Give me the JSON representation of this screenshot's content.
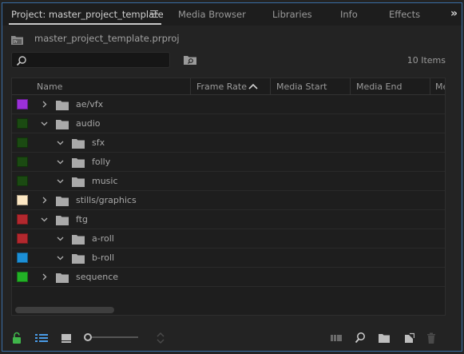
{
  "tabs": [
    {
      "label": "Project: master_project_template",
      "active": true
    },
    {
      "label": "Media Browser"
    },
    {
      "label": "Libraries"
    },
    {
      "label": "Info"
    },
    {
      "label": "Effects"
    }
  ],
  "tab_overflow_label": "»",
  "project_file": "master_project_template.prproj",
  "search": {
    "value": "",
    "placeholder": ""
  },
  "item_count": "10 Items",
  "columns": [
    "Name",
    "Frame Rate",
    "Media Start",
    "Media End",
    "Me"
  ],
  "sorted_column": "Frame Rate",
  "sort_direction": "ascending",
  "rows": [
    {
      "label": "ae/vfx",
      "color": "#9b30d9",
      "expanded": false
    },
    {
      "label": "audio",
      "color": "#1b4a12",
      "expanded": true
    },
    {
      "label": "sfx",
      "color": "#1b4a12",
      "expanded": true
    },
    {
      "label": "folly",
      "color": "#1b4a12",
      "expanded": true
    },
    {
      "label": "music",
      "color": "#1b4a12",
      "expanded": true
    },
    {
      "label": "stills/graphics",
      "color": "#fde8c4",
      "expanded": false
    },
    {
      "label": "ftg",
      "color": "#b3282e",
      "expanded": true
    },
    {
      "label": "a-roll",
      "color": "#b3282e",
      "expanded": true
    },
    {
      "label": "b-roll",
      "color": "#1c8fd6",
      "expanded": true
    },
    {
      "label": "sequence",
      "color": "#22b126",
      "expanded": false
    }
  ],
  "toolbar": {
    "icons": [
      "lock-icon",
      "list-view-icon",
      "icon-view-icon",
      "zoom-slider",
      "sort-icons-icon",
      "automate-to-sequence-icon",
      "find-icon",
      "new-bin-icon",
      "new-item-icon",
      "clear-icon"
    ]
  },
  "colors": {
    "accent_border": "#3a6ea5",
    "lock_green": "#3fb54a",
    "list_view_blue": "#4a9be6"
  }
}
